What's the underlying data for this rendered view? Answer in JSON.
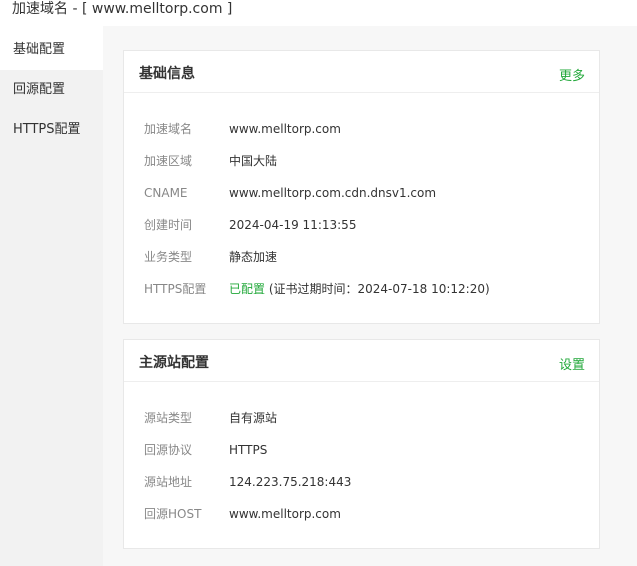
{
  "topbar": {
    "title": "加速域名 - [ www.melltorp.com ]"
  },
  "sidebar": {
    "items": [
      {
        "label": "基础配置"
      },
      {
        "label": "回源配置"
      },
      {
        "label": "HTTPS配置"
      }
    ]
  },
  "basic_info": {
    "title": "基础信息",
    "more_link": "更多",
    "rows": [
      {
        "label": "加速域名",
        "value": "www.melltorp.com"
      },
      {
        "label": "加速区域",
        "value": "中国大陆"
      },
      {
        "label": "CNAME",
        "value": "www.melltorp.com.cdn.dnsv1.com"
      },
      {
        "label": "创建时间",
        "value": "2024-04-19 11:13:55"
      },
      {
        "label": "业务类型",
        "value": "静态加速"
      },
      {
        "label": "HTTPS配置",
        "status": "已配置",
        "detail": " (证书过期时间：2024-07-18 10:12:20)"
      }
    ]
  },
  "origin_config": {
    "title": "主源站配置",
    "settings_link": "设置",
    "rows": [
      {
        "label": "源站类型",
        "value": "自有源站"
      },
      {
        "label": "回源协议",
        "value": "HTTPS"
      },
      {
        "label": "源站地址",
        "value": "124.223.75.218:443"
      },
      {
        "label": "回源HOST",
        "value": "www.melltorp.com"
      }
    ]
  },
  "colors": {
    "accent_green": "#22a83a",
    "sidebar_bg": "#f2f2f2",
    "main_bg": "#f7f7f7"
  }
}
